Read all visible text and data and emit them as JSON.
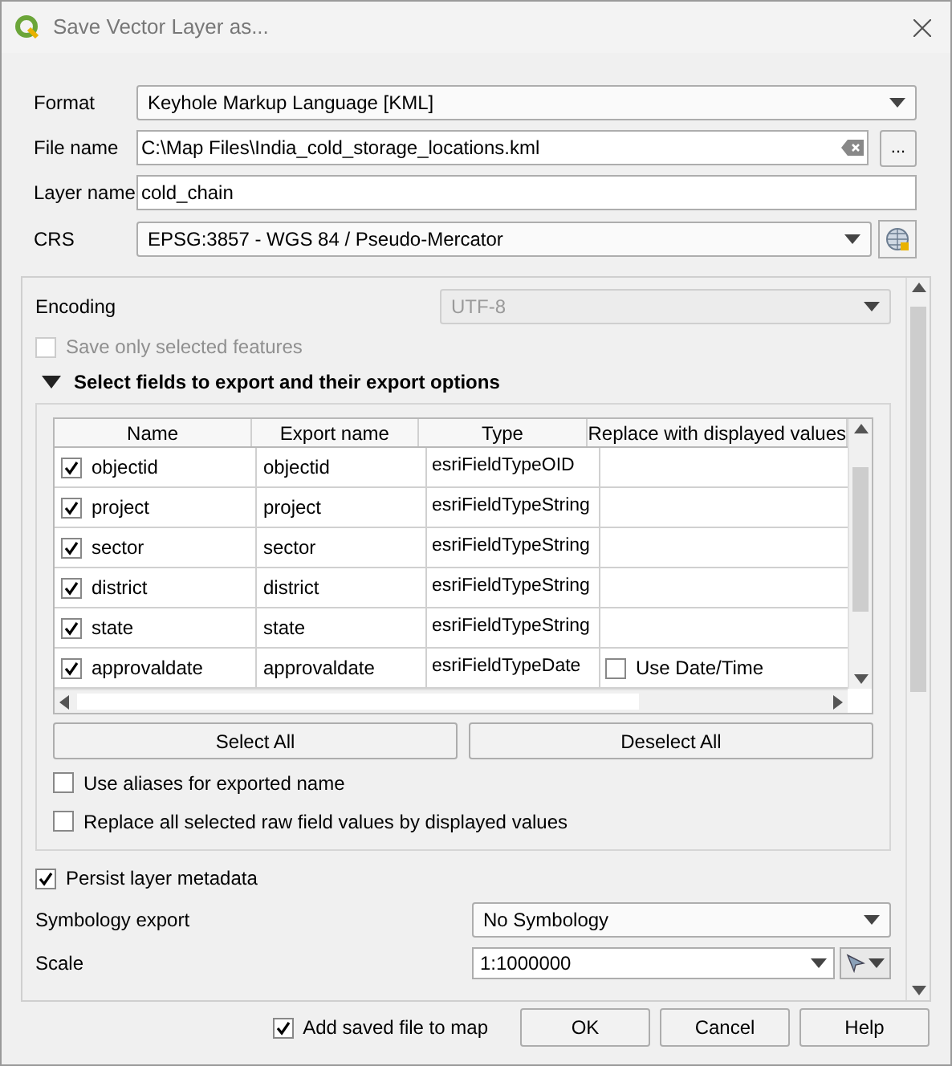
{
  "window": {
    "title": "Save Vector Layer as..."
  },
  "form": {
    "format": {
      "label": "Format",
      "value": "Keyhole Markup Language [KML]"
    },
    "file_name": {
      "label": "File name",
      "value": "C:\\Map Files\\India_cold_storage_locations.kml",
      "browse": "..."
    },
    "layer_name": {
      "label": "Layer name",
      "value": "cold_chain"
    },
    "crs": {
      "label": "CRS",
      "value": "EPSG:3857 - WGS 84 / Pseudo-Mercator"
    }
  },
  "options": {
    "encoding": {
      "label": "Encoding",
      "value": "UTF-8",
      "disabled": true
    },
    "save_selected": {
      "label": "Save only selected features",
      "checked": false,
      "disabled": true
    },
    "fields_group": {
      "title": "Select fields to export and their export options",
      "expanded": true,
      "columns": [
        "Name",
        "Export name",
        "Type",
        "Replace with displayed values"
      ],
      "rows": [
        {
          "name": "objectid",
          "checked": true,
          "export_name": "objectid",
          "type": "esriFieldTypeOID"
        },
        {
          "name": "project",
          "checked": true,
          "export_name": "project",
          "type": "esriFieldTypeString"
        },
        {
          "name": "sector",
          "checked": true,
          "export_name": "sector",
          "type": "esriFieldTypeString"
        },
        {
          "name": "district",
          "checked": true,
          "export_name": "district",
          "type": "esriFieldTypeString"
        },
        {
          "name": "state",
          "checked": true,
          "export_name": "state",
          "type": "esriFieldTypeString"
        },
        {
          "name": "approvaldate",
          "checked": true,
          "export_name": "approvaldate",
          "type": "esriFieldTypeDate",
          "replace": {
            "label": "Use Date/Time",
            "checked": false
          }
        }
      ],
      "buttons": [
        "Select All",
        "Deselect All"
      ],
      "checkboxes": [
        {
          "label": "Use aliases for exported name",
          "checked": false
        },
        {
          "label": "Replace all selected raw field values by displayed values",
          "checked": false
        }
      ]
    },
    "persist_metadata": {
      "label": "Persist layer metadata",
      "checked": true
    },
    "symbology": {
      "label": "Symbology export",
      "value": "No Symbology"
    },
    "scale": {
      "label": "Scale",
      "value": "1:1000000"
    }
  },
  "footer": {
    "add_to_map": {
      "label": "Add saved file to map",
      "checked": true
    },
    "buttons": [
      "OK",
      "Cancel",
      "Help"
    ]
  }
}
